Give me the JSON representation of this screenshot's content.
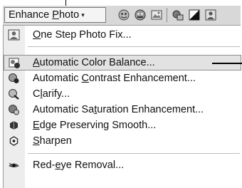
{
  "toolbar": {
    "dropdown": {
      "label_pre": "Enhance ",
      "label_accel": "P",
      "label_post": "hoto",
      "arrow": "▾"
    },
    "icons": [
      "faces-icon",
      "faces-alt-icon",
      "photo-frame-icon",
      "color-blob-icon",
      "contrast-icon",
      "person-adjust-icon"
    ]
  },
  "menu": {
    "items": [
      {
        "id": "one-step",
        "pre": "",
        "accel": "O",
        "post": "ne Step Photo Fix...",
        "icon": "portrait-icon"
      },
      {
        "id": "auto-color",
        "pre": "",
        "accel": "A",
        "post": "utomatic Color Balance...",
        "icon": "color-balance-icon",
        "highlighted": true
      },
      {
        "id": "auto-contrast",
        "pre": "Automatic ",
        "accel": "C",
        "post": "ontrast Enhancement...",
        "icon": "contrast-enhance-icon"
      },
      {
        "id": "clarify",
        "pre": "C",
        "accel": "l",
        "post": "arify...",
        "icon": "clarify-icon"
      },
      {
        "id": "auto-saturation",
        "pre": "Automatic Sa",
        "accel": "t",
        "post": "uration Enhancement...",
        "icon": "saturation-icon"
      },
      {
        "id": "edge-smooth",
        "pre": "",
        "accel": "E",
        "post": "dge Preserving Smooth...",
        "icon": "edge-smooth-icon"
      },
      {
        "id": "sharpen",
        "pre": "",
        "accel": "S",
        "post": "harpen",
        "icon": "sharpen-icon"
      },
      {
        "id": "red-eye",
        "pre": "Red-",
        "accel": "e",
        "post": "ye Removal...",
        "icon": "eye-icon"
      }
    ]
  }
}
